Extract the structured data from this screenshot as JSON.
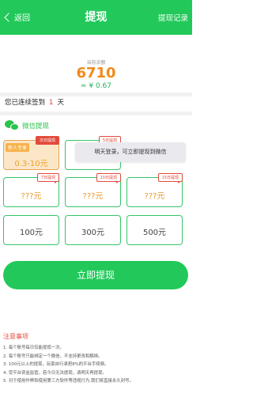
{
  "header": {
    "back_label": "返回",
    "title": "提现",
    "records_label": "提现记录"
  },
  "balance": {
    "label": "当前余额",
    "value": "6710",
    "cny": "≈ ¥ 0.67"
  },
  "signin": {
    "prefix": "您已连续签到",
    "days": "1",
    "suffix": "天"
  },
  "method": {
    "label": "微信提现"
  },
  "options": {
    "row1": [
      {
        "tag": "次日提现",
        "amount": "0.3-10元",
        "badge": "新人专享",
        "selected": true
      },
      {
        "tag": "5日提现",
        "amount": ""
      }
    ],
    "row2": [
      {
        "tag": "7日提现",
        "amount": "???元"
      },
      {
        "tag": "10日提现",
        "amount": "???元"
      },
      {
        "tag": "15日提现",
        "amount": "???元"
      }
    ],
    "row3": [
      {
        "amount": "100元"
      },
      {
        "amount": "300元"
      },
      {
        "amount": "500元"
      }
    ]
  },
  "tooltip": "明天登录，可立即提现到微信",
  "withdraw_button": "立即提现",
  "notes": {
    "title": "注意事项",
    "items": [
      "1. 每个账号每日仅能提现一次。",
      "2. 每个账号只能绑定一个微信，不支持更改和解绑。",
      "3. 100元以上的提现，玩家自行承担8%的平台手续费。",
      "4. 受平台资金监管，若今日无法提现，请明天再提现。",
      "5. 对于使用作弊和使用第三方软件等违规行为,我们将直接永久封号。"
    ]
  },
  "colors": {
    "primary_green": "#22c95a",
    "accent_orange": "#f08a1c",
    "alert_red": "#e24a3b"
  }
}
